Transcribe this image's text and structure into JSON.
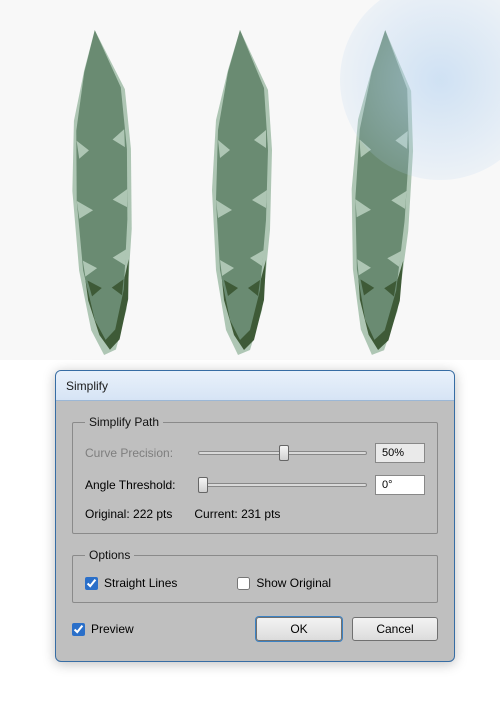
{
  "dialog": {
    "title": "Simplify",
    "simplify_path": {
      "legend": "Simplify Path",
      "curve_precision_label": "Curve Precision:",
      "curve_precision_value": "50%",
      "angle_threshold_label": "Angle Threshold:",
      "angle_threshold_value": "0°",
      "original_label": "Original: 222 pts",
      "current_label": "Current: 231 pts"
    },
    "options": {
      "legend": "Options",
      "straight_lines_label": "Straight Lines",
      "straight_lines_checked": true,
      "show_original_label": "Show Original",
      "show_original_checked": false
    },
    "preview_label": "Preview",
    "preview_checked": true,
    "ok_label": "OK",
    "cancel_label": "Cancel"
  }
}
